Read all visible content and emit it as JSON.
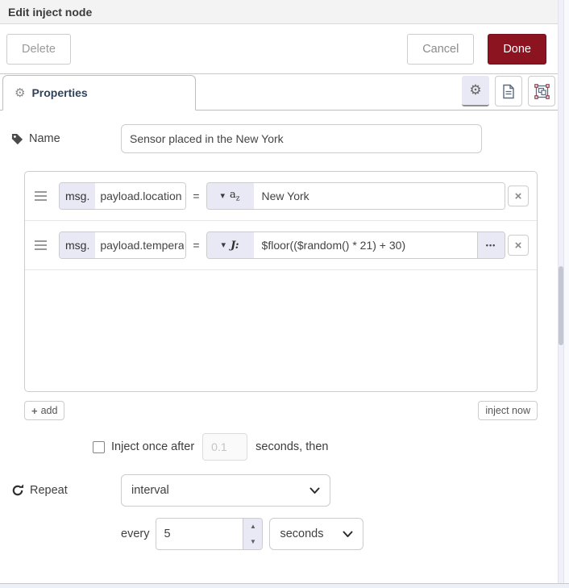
{
  "dialog": {
    "title": "Edit inject node"
  },
  "toolbar": {
    "delete": "Delete",
    "cancel": "Cancel",
    "done": "Done"
  },
  "tabbar": {
    "properties": "Properties"
  },
  "form": {
    "name_label": "Name",
    "name_value": "Sensor placed in the New York",
    "rules": [
      {
        "prefix": "msg.",
        "property": "payload.location",
        "op": "=",
        "type": "string",
        "value": "New York"
      },
      {
        "prefix": "msg.",
        "property": "payload.temperature",
        "op": "=",
        "type": "expression",
        "value": "$floor(($random() * 21) + 30)"
      }
    ],
    "add_button": "add",
    "inject_now_button": "inject now",
    "once_label": "Inject once after",
    "once_delay_value": "0.1",
    "once_suffix": "seconds, then",
    "repeat_label": "Repeat",
    "repeat_value": "interval",
    "every_label": "every",
    "every_value": "5",
    "every_unit": "seconds"
  },
  "icons": {
    "gear": "⚙",
    "caret_down": "▾",
    "string_type_main": "a",
    "string_type_sub": "z",
    "expression_type": "J:",
    "ellipsis": "•••",
    "close": "×",
    "plus": "+",
    "spin_up": "▲",
    "spin_down": "▼"
  },
  "colors": {
    "done_bg": "#8C1421",
    "accent": "#e8e9f4",
    "header_bg": "#f3f3f3"
  }
}
